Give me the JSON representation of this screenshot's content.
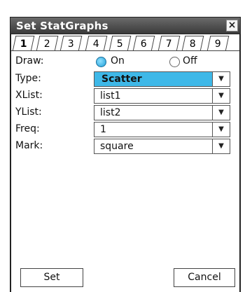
{
  "window": {
    "title": "Set StatGraphs",
    "close_glyph": "×"
  },
  "tabs": [
    "1",
    "2",
    "3",
    "4",
    "5",
    "6",
    "7",
    "8",
    "9"
  ],
  "form": {
    "draw": {
      "label": "Draw:",
      "on_label": "On",
      "off_label": "Off",
      "selected": "On"
    },
    "type": {
      "label": "Type:",
      "value": "Scatter"
    },
    "xlist": {
      "label": "XList:",
      "value": "list1"
    },
    "ylist": {
      "label": "YList:",
      "value": "list2"
    },
    "freq": {
      "label": "Freq:",
      "value": "1"
    },
    "mark": {
      "label": "Mark:",
      "value": "square"
    }
  },
  "buttons": {
    "set": "Set",
    "cancel": "Cancel"
  },
  "dropdown_glyph": "▼",
  "colors": {
    "selected_field": "#3eb8e8",
    "titlebar": "#4a4a4a"
  }
}
